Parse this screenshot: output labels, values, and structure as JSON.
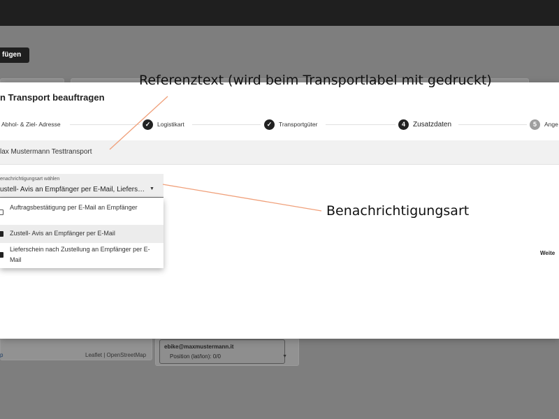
{
  "background": {
    "add_button_label": "fügen",
    "map_attribution": "Leaflet | OpenStreetMap",
    "map_tip": "p",
    "email": "ebike@maxmustermann.it",
    "position": "Position (lat/lon): 0/0"
  },
  "dialog": {
    "title": "n Transport beauftragen",
    "steps": [
      {
        "label": "Abhol- & Ziel- Adresse",
        "state": "done"
      },
      {
        "label": "Logistikart",
        "state": "done"
      },
      {
        "label": "Transportgüter",
        "state": "done"
      },
      {
        "number": "4",
        "label": "Zusatzdaten",
        "state": "active"
      },
      {
        "number": "5",
        "label": "Ange",
        "state": "todo"
      }
    ],
    "reference_text": "lax Mustermann Testtransport",
    "notification_select": {
      "label": "enachrichtigungsart wählen",
      "value": "ustell- Avis an Empfänger per E-Mail, Liefers…"
    },
    "options": [
      {
        "label": "Auftragsbestätigung per E-Mail an Empfänger",
        "checked": false
      },
      {
        "label": "Zustell- Avis an Empfänger per E-Mail",
        "checked": true
      },
      {
        "label": "Lieferschein nach Zustellung an Empfänger per E-Mail",
        "checked": true
      }
    ],
    "next_button": "Weite"
  },
  "annotations": {
    "reference": "Referenztext (wird beim Transportlabel mit gedruckt)",
    "notification": "Benachrichtigungsart"
  },
  "colors": {
    "accent_line": "#f0a07a",
    "topbar": "#1f1f1f",
    "overlay": "#7e7e7e"
  }
}
